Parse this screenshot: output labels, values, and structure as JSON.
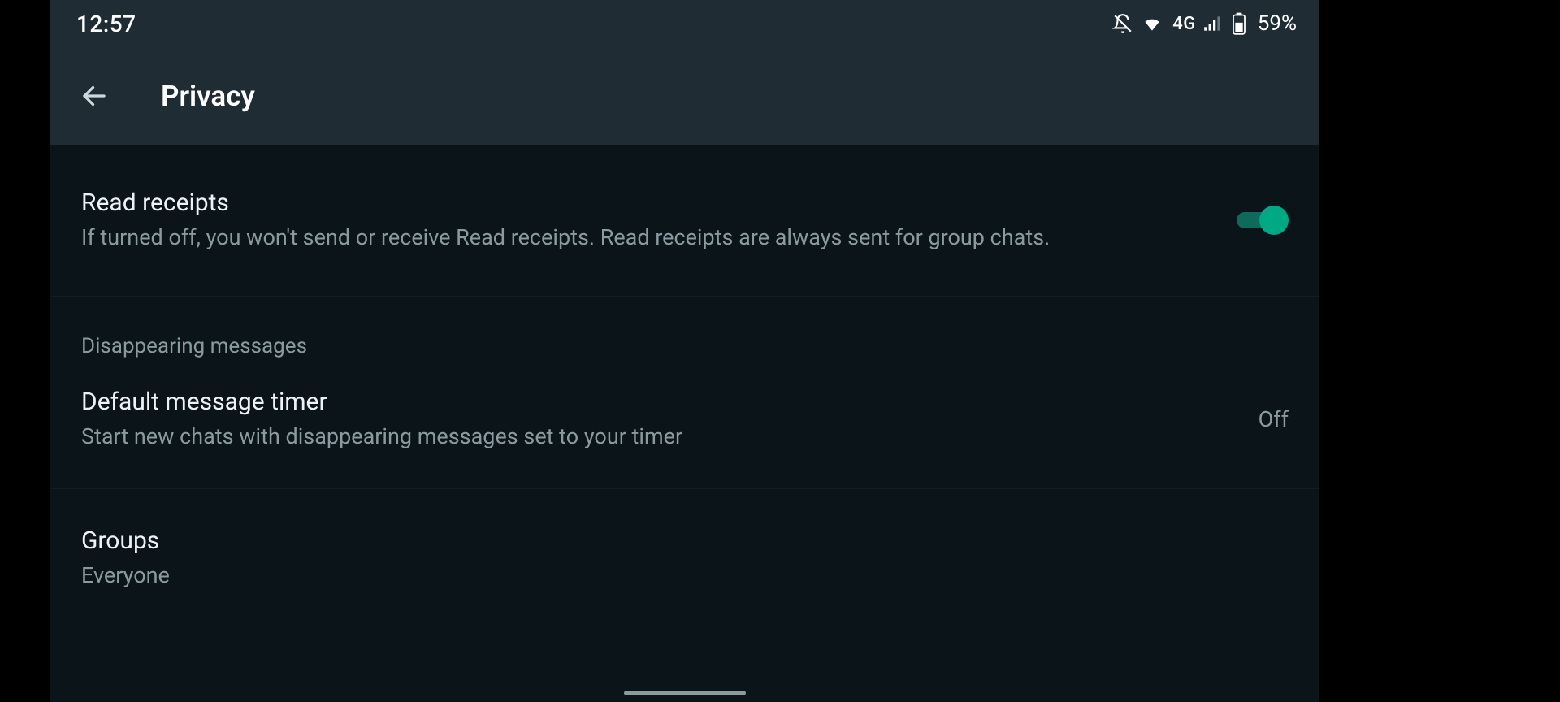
{
  "status": {
    "time": "12:57",
    "network_label": "4G",
    "battery_pct": "59%"
  },
  "header": {
    "title": "Privacy"
  },
  "rows": {
    "read_receipts": {
      "title": "Read receipts",
      "sub": "If turned off, you won't send or receive Read receipts. Read receipts are always sent for group chats.",
      "enabled": true
    },
    "disappearing_section": "Disappearing messages",
    "default_timer": {
      "title": "Default message timer",
      "sub": "Start new chats with disappearing messages set to your timer",
      "value": "Off"
    },
    "groups": {
      "title": "Groups",
      "sub": "Everyone"
    }
  },
  "colors": {
    "accent": "#00a884",
    "bg_dark": "#0b1418",
    "bg_bar": "#1f2c33"
  }
}
